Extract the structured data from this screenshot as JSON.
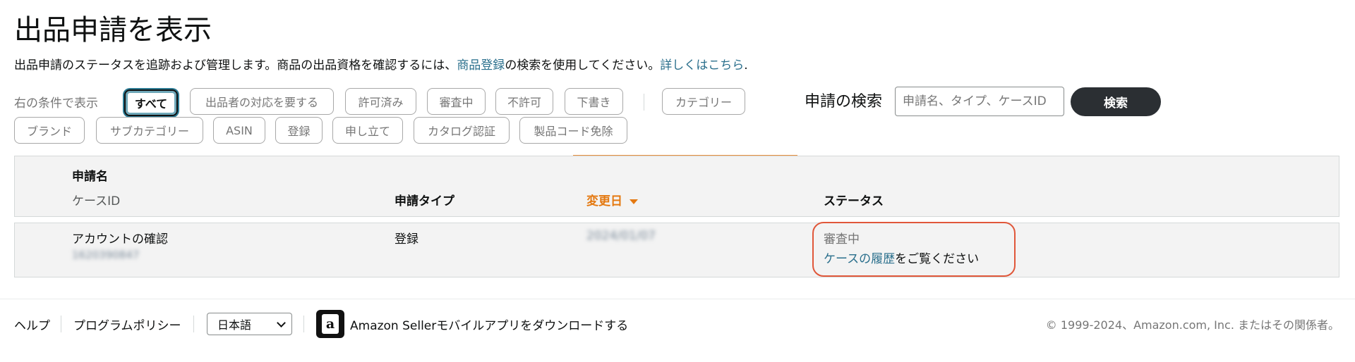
{
  "page": {
    "title": "出品申請を表示",
    "description_prefix": "出品申請のステータスを追跡および管理します。商品の出品資格を確認するには、",
    "description_link1": "商品登録",
    "description_middle": "の検索を使用してください。",
    "description_link2": "詳しくはこちら",
    "description_suffix": "."
  },
  "filters": {
    "label": "右の条件で表示",
    "chips": [
      "すべて",
      "出品者の対応を要する",
      "許可済み",
      "審査中",
      "不許可",
      "下書き",
      "カテゴリー",
      "ブランド",
      "サブカテゴリー",
      "ASIN",
      "登録",
      "申し立て",
      "カタログ認証",
      "製品コード免除"
    ],
    "active": "すべて"
  },
  "search": {
    "label": "申請の検索",
    "placeholder": "申請名、タイプ、ケースID",
    "button": "検索"
  },
  "table": {
    "headers": {
      "name": "申請名",
      "case_id": "ケースID",
      "type": "申請タイプ",
      "date": "変更日",
      "status": "ステータス"
    },
    "rows": [
      {
        "name": "アカウントの確認",
        "case_id": "1620390847",
        "type": "登録",
        "date": "2024/01/07",
        "status": "審査中",
        "history_link": "ケースの履歴",
        "history_suffix": "をご覧ください"
      }
    ]
  },
  "footer": {
    "help": "ヘルプ",
    "policy": "プログラムポリシー",
    "language": "日本語",
    "app_icon": "amazon-a-icon",
    "app_link": "Amazon Sellerモバイルアプリをダウンロードする",
    "copyright": "© 1999-2024、Amazon.com, Inc. またはその関係者。"
  },
  "colors": {
    "accent_orange": "#e47911",
    "link_teal": "#2a6f8c",
    "highlight_red": "#e0573a",
    "dark_button": "#2b2f33"
  }
}
